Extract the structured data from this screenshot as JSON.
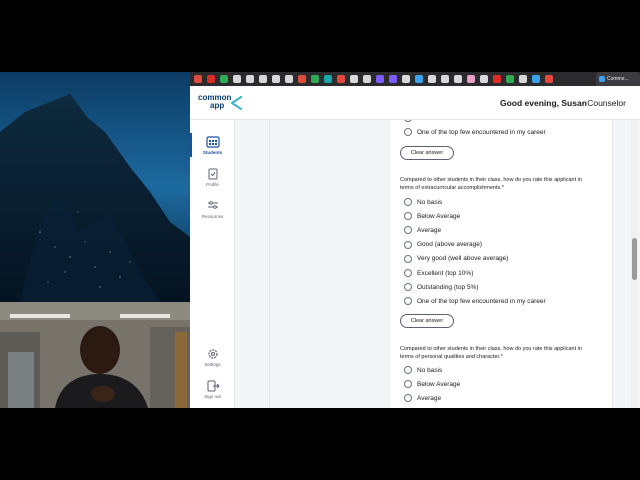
{
  "browser": {
    "active_tab_title": "Comme...",
    "favicon_colors": [
      "#e24b3b",
      "#e02a2a",
      "#2faa55",
      "#d8d8d8",
      "#d8d8d8",
      "#d8d8d8",
      "#d8d8d8",
      "#d8d8d8",
      "#e24b3b",
      "#2faa55",
      "#1aa7a7",
      "#e24b3b",
      "#d8d8d8",
      "#d8d8d8",
      "#7a5cff",
      "#7a5cff",
      "#d8d8d8",
      "#3aa3f0",
      "#d8d8d8",
      "#d8d8d8",
      "#d8d8d8",
      "#e8a0c8",
      "#d8d8d8",
      "#e02a2a",
      "#2faa55",
      "#d8d8d8",
      "#3aa3f0",
      "#e24b3b"
    ]
  },
  "header": {
    "logo_line1": "common",
    "logo_line2": "app",
    "greeting": "Good evening, Susan",
    "role": "Counselor"
  },
  "sidebar": {
    "items": [
      {
        "label": "Students",
        "icon": "students-icon"
      },
      {
        "label": "Profile",
        "icon": "profile-icon"
      },
      {
        "label": "Resources",
        "icon": "resources-icon"
      },
      {
        "label": "Settings",
        "icon": "gear-icon"
      },
      {
        "label": "Sign out",
        "icon": "sign-out-icon"
      }
    ]
  },
  "form": {
    "prev_last_option": "One of the top few encountered in my career",
    "clear_label": "Clear answer",
    "q_extracurricular": "Compared to other students in their class, how do you rate this applicant in terms of extracurricular accomplishments.*",
    "q_personal": "Compared to other students in their class, how do you rate this applicant in terms of personal qualities and character.*",
    "options": [
      "No basis",
      "Below Average",
      "Average",
      "Good (above average)",
      "Very good (well above average)",
      "Excellent (top 10%)",
      "Outstanding (top 5%)",
      "One of the top few encountered in my career"
    ]
  },
  "colors": {
    "brand_navy": "#0b3a6f",
    "brand_teal": "#3fb6c8",
    "nav_active": "#1d4fa0"
  }
}
